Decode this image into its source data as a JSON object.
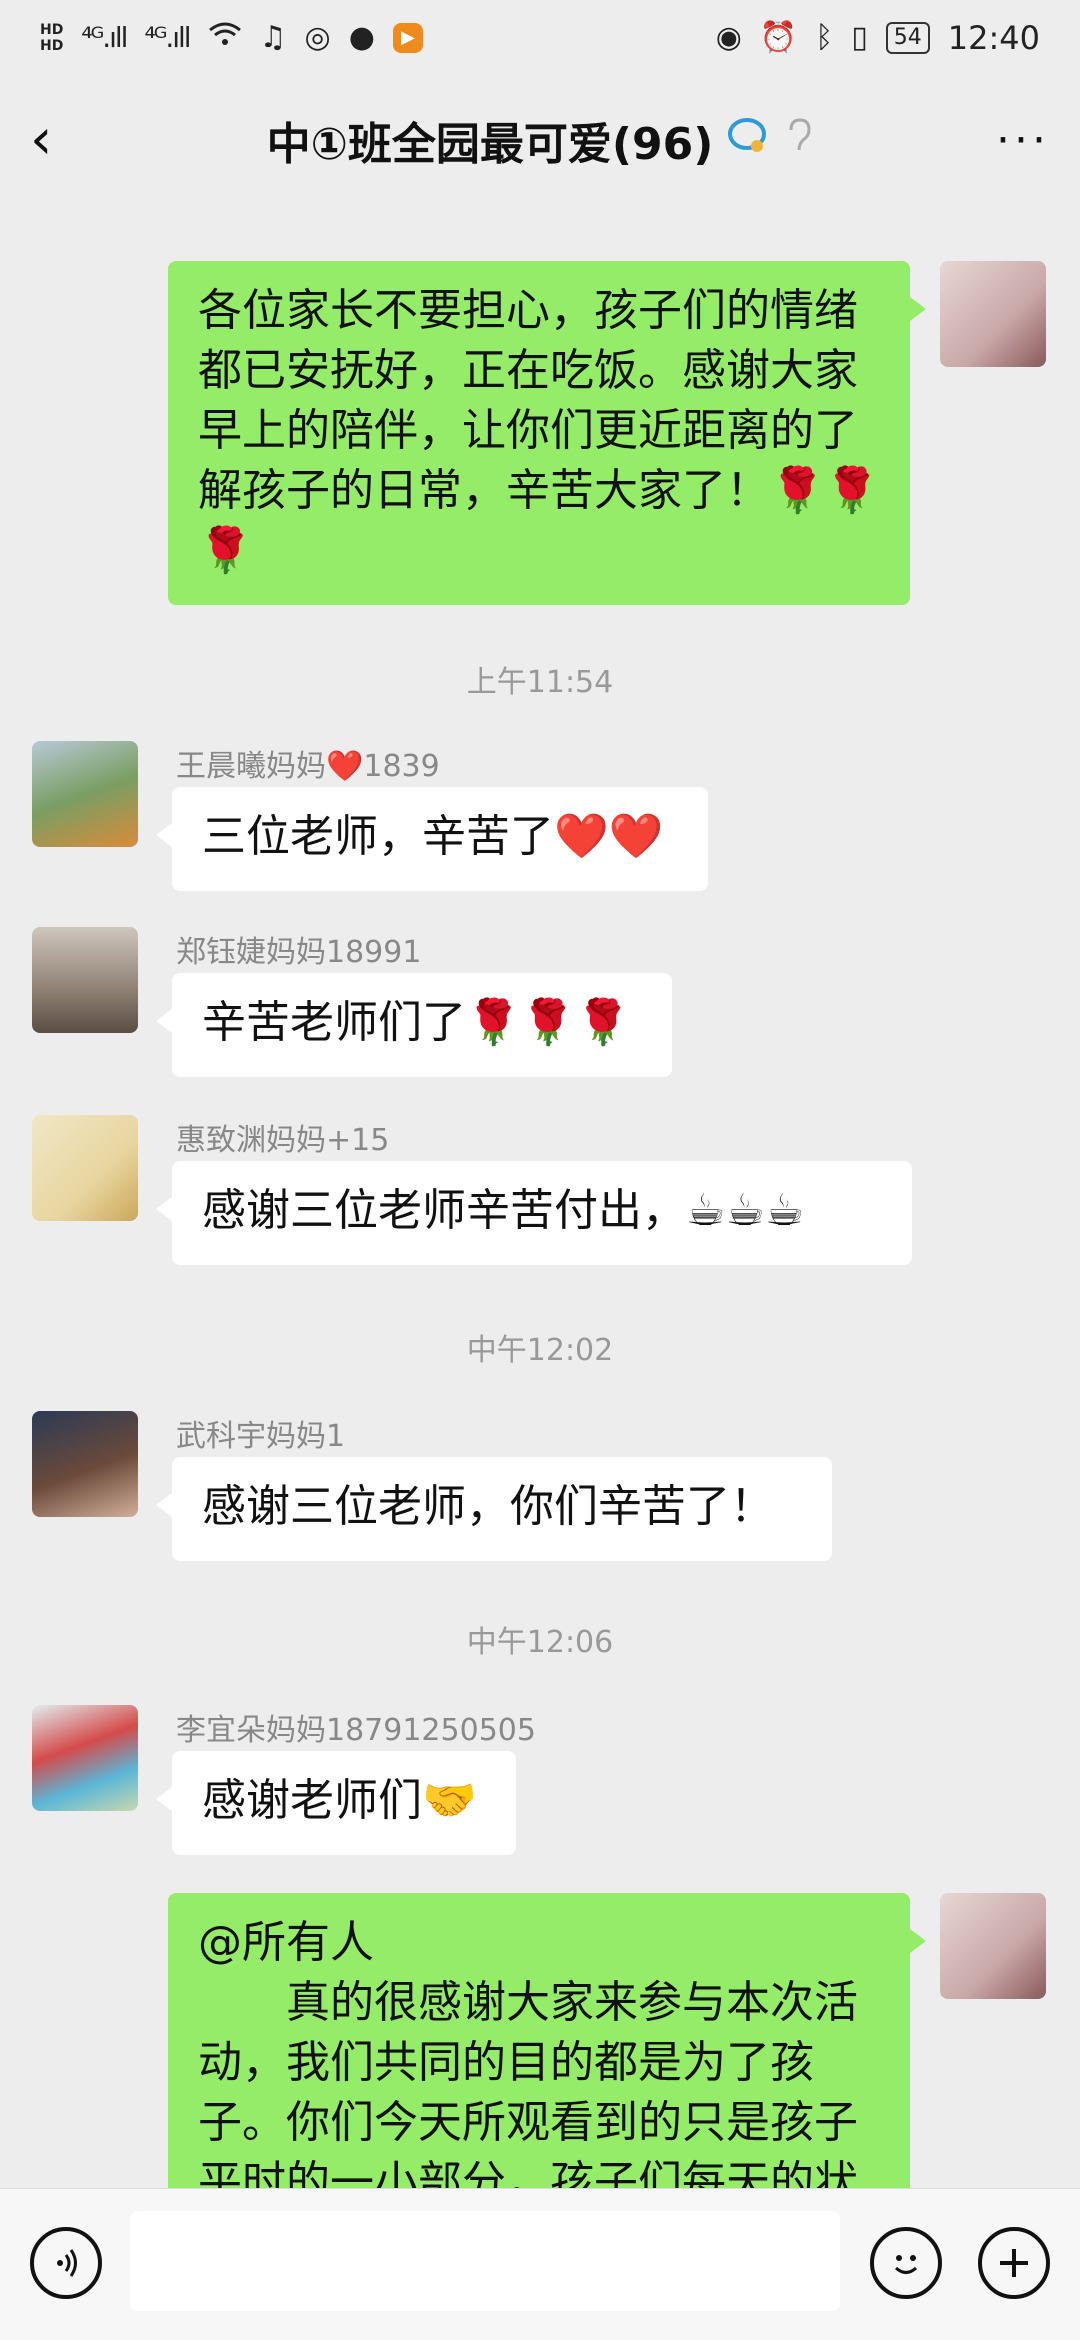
{
  "status": {
    "hd1": "HD",
    "hd2": "HD",
    "sig1": "⁴ᴳ.ıll",
    "sig2": "⁴ᴳ.ıll",
    "battery": "54",
    "time": "12:40"
  },
  "header": {
    "back": "‹",
    "title": "中①班全园最可爱(96)",
    "more": "···"
  },
  "messages": {
    "m1": {
      "text": "各位家长不要担心，孩子们的情绪都已安抚好，正在吃饭。感谢大家早上的陪伴，让你们更近距离的了解孩子的日常，辛苦大家了！🌹🌹🌹"
    },
    "t1": "上午11:54",
    "m2": {
      "sender": "王晨曦妈妈❤️1839",
      "text": "三位老师，辛苦了❤️❤️"
    },
    "m3": {
      "sender": "郑钰婕妈妈18991",
      "text": "辛苦老师们了🌹🌹🌹"
    },
    "m4": {
      "sender": "惠致渊妈妈+15",
      "text": "感谢三位老师辛苦付出，☕☕☕"
    },
    "t2": "中午12:02",
    "m5": {
      "sender": "武科宇妈妈1",
      "text": "感谢三位老师，你们辛苦了！"
    },
    "t3": "中午12:06",
    "m6": {
      "sender": "李宜朵妈妈18791250505",
      "text": "感谢老师们🤝"
    },
    "m7": {
      "line1": "@所有人",
      "text": "　　真的很感谢大家来参与本次活动，我们共同的目的都是为了孩子。你们今天所观看到的只是孩子平时的一小部分，孩子们每天的状"
    }
  },
  "colors": {
    "background": "#ededed",
    "bubble_self": "#95ec69",
    "bubble_other": "#ffffff"
  },
  "icons": {
    "voice": "voice-icon",
    "emoji": "emoji-icon",
    "plus": "plus-icon"
  }
}
